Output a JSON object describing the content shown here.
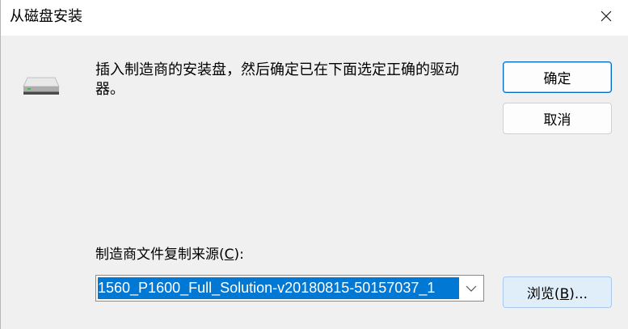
{
  "window": {
    "title": "从磁盘安装",
    "close_icon": "close-icon"
  },
  "icon": "disk-drive-icon",
  "instructions": "插入制造商的安装盘，然后确定已在下面选定正确的驱动器。",
  "buttons": {
    "ok": "确定",
    "cancel": "取消",
    "browse": {
      "text": "浏览(",
      "access_key": "B",
      "suffix": ")..."
    }
  },
  "source": {
    "label": {
      "text": "制造商文件复制来源(",
      "access_key": "C",
      "suffix": "):"
    },
    "value": "1560_P1600_Full_Solution-v20180815-50157037_1",
    "dropdown_icon": "chevron-down-icon"
  },
  "colors": {
    "accent": "#0078d4",
    "titlebar": "#ffffff",
    "background": "#f0f0f0"
  }
}
